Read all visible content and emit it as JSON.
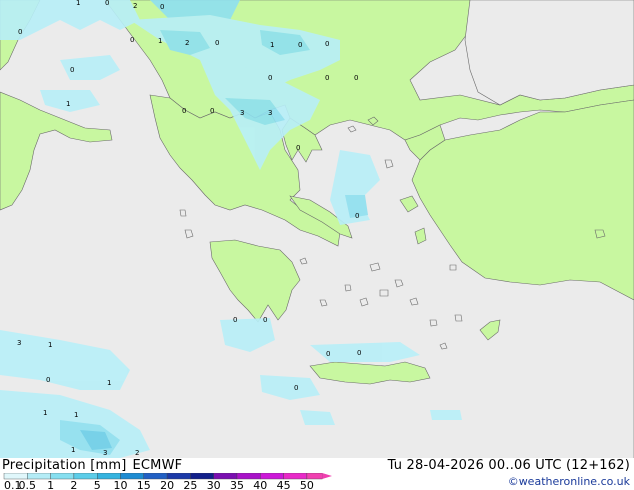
{
  "legend": {
    "title": "Precipitation [mm]",
    "model": "ECMWF",
    "values": [
      "0.1",
      "0.5",
      "1",
      "2",
      "5",
      "10",
      "15",
      "20",
      "25",
      "30",
      "35",
      "40",
      "45",
      "50"
    ],
    "colors": [
      "#e0f7fb",
      "#b4ecf6",
      "#86dff0",
      "#5ccde9",
      "#34b3df",
      "#1e8cd2",
      "#2260c4",
      "#1c3aa8",
      "#12208a",
      "#7a0fb0",
      "#a812c8",
      "#cc19d8",
      "#e82ac8",
      "#f040b0"
    ]
  },
  "valid_time": "Tu 28-04-2026 00..06 UTC (12+162)",
  "credit": "©weatheronline.co.uk",
  "map_colors": {
    "sea": "#ebebeb",
    "land": "#c8f7a0",
    "border": "#6a6a6a",
    "precip_light": "#b8eff8",
    "precip_mid": "#8fe0f0",
    "precip_dark": "#6ccfe8"
  },
  "map_labels": [
    {
      "id": "l1",
      "text": "1"
    },
    {
      "id": "l2",
      "text": "2"
    },
    {
      "id": "l3",
      "text": "0"
    },
    {
      "id": "l4",
      "text": "0"
    },
    {
      "id": "l5",
      "text": "0"
    },
    {
      "id": "l6",
      "text": "1"
    },
    {
      "id": "l7",
      "text": "2"
    },
    {
      "id": "l8",
      "text": "0"
    },
    {
      "id": "l9",
      "text": "1"
    },
    {
      "id": "l10",
      "text": "0"
    },
    {
      "id": "l11",
      "text": "0"
    },
    {
      "id": "l12",
      "text": "0"
    },
    {
      "id": "l13",
      "text": "0"
    },
    {
      "id": "l14",
      "text": "0"
    },
    {
      "id": "l15",
      "text": "0"
    },
    {
      "id": "l16",
      "text": "1"
    },
    {
      "id": "l17",
      "text": "0"
    },
    {
      "id": "l18",
      "text": "0"
    },
    {
      "id": "l19",
      "text": "3"
    },
    {
      "id": "l20",
      "text": "3"
    },
    {
      "id": "l21",
      "text": "0"
    },
    {
      "id": "l22",
      "text": "0"
    },
    {
      "id": "l23",
      "text": "0"
    },
    {
      "id": "l24",
      "text": "0"
    },
    {
      "id": "l25",
      "text": "3"
    },
    {
      "id": "l26",
      "text": "1"
    },
    {
      "id": "l27",
      "text": "0"
    },
    {
      "id": "l28",
      "text": "1"
    },
    {
      "id": "l29",
      "text": "0"
    },
    {
      "id": "l30",
      "text": "0"
    },
    {
      "id": "l31",
      "text": "0"
    },
    {
      "id": "l32",
      "text": "1"
    },
    {
      "id": "l33",
      "text": "1"
    },
    {
      "id": "l34",
      "text": "1"
    },
    {
      "id": "l35",
      "text": "3"
    },
    {
      "id": "l36",
      "text": "2"
    },
    {
      "id": "l37",
      "text": "0"
    }
  ]
}
